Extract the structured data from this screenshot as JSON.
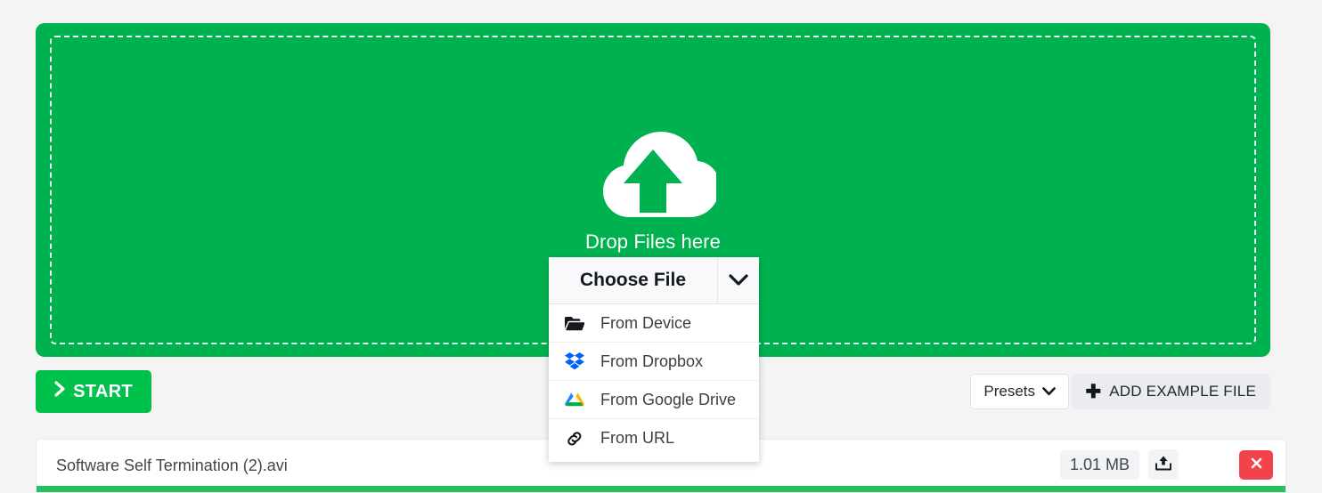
{
  "dropzone": {
    "icon": "cloud-upload-icon",
    "text": "Drop Files here",
    "background_color": "#00b14f"
  },
  "choose_file": {
    "label": "Choose File",
    "caret_icon": "chevron-down-icon",
    "menu_items": [
      {
        "label": "From Device",
        "icon": "folder-open-icon"
      },
      {
        "label": "From Dropbox",
        "icon": "dropbox-icon"
      },
      {
        "label": "From Google Drive",
        "icon": "google-drive-icon"
      },
      {
        "label": "From URL",
        "icon": "link-icon"
      }
    ]
  },
  "actions": {
    "start_label": "START",
    "start_icon": "chevron-right-icon",
    "start_color": "#00c14c",
    "presets_label": "Presets",
    "presets_icon": "chevron-down-icon",
    "add_example_label": "ADD EXAMPLE FILE",
    "add_example_icon": "plus-icon"
  },
  "file_row": {
    "name": "Software Self Termination (2).avi",
    "size": "1.01 MB",
    "save_icon": "upload-save-icon",
    "delete_icon": "close-x-icon",
    "delete_color": "#f2434d",
    "progress_percent": 100,
    "progress_color": "#25c15e"
  }
}
